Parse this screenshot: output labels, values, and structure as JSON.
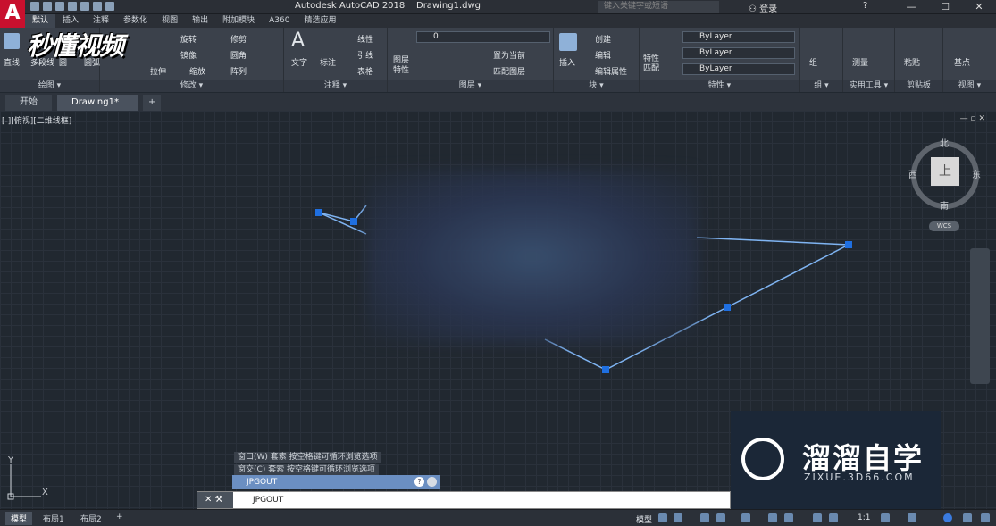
{
  "app": {
    "logo_letter": "A",
    "title": "Autodesk AutoCAD 2018",
    "file": "Drawing1.dwg",
    "search_placeholder": "键入关键字或短语",
    "login": "登录",
    "help": "?"
  },
  "window_buttons": [
    "—",
    "☐",
    "✕"
  ],
  "menu_tabs": [
    "默认",
    "插入",
    "注释",
    "参数化",
    "视图",
    "输出",
    "附加模块",
    "A360",
    "精选应用"
  ],
  "watermark_top": "秒懂视频",
  "ribbon": {
    "draw": {
      "label": "绘图 ▾",
      "tool1": "直线",
      "tool2": "多段线",
      "tool3": "圆",
      "tool4": "圆弧"
    },
    "modify": {
      "label": "修改 ▾",
      "items": [
        "旋转",
        "修剪",
        "镜像",
        "圆角",
        "缩放",
        "阵列",
        "拉伸"
      ]
    },
    "annotation": {
      "label": "注释 ▾",
      "text": "文字",
      "dim": "标注",
      "linear": "线性",
      "leader": "引线",
      "table": "表格"
    },
    "layers": {
      "label": "图层 ▾",
      "props": "图层\n特性",
      "current_layer": "0",
      "set_current": "置为当前",
      "match": "匹配图层"
    },
    "block": {
      "label": "块 ▾",
      "insert": "插入",
      "create": "创建",
      "edit": "编辑",
      "edit_attr": "编辑属性"
    },
    "properties": {
      "label": "特性 ▾",
      "match": "特性\n匹配",
      "color": "ByLayer",
      "linetype": "ByLayer",
      "lineweight": "ByLayer"
    },
    "groups": {
      "label": "组 ▾",
      "group": "组"
    },
    "utilities": {
      "label": "实用工具 ▾",
      "measure": "测量"
    },
    "clipboard": {
      "label": "剪贴板",
      "paste": "粘贴"
    },
    "view": {
      "label": "视图 ▾",
      "base": "基点"
    }
  },
  "doc_tabs": [
    "开始",
    "Drawing1*"
  ],
  "viewport_label": "[-][俯视][二维线框]",
  "viewcube": {
    "face": "上",
    "north": "北",
    "south": "南",
    "east": "东",
    "west": "西",
    "wcs": "WCS"
  },
  "ucs": {
    "x": "X",
    "y": "Y"
  },
  "command_history": [
    "窗口(W) 套索  按空格键可循环浏览选项",
    "窗交(C) 套索  按空格键可循环浏览选项"
  ],
  "command_popup": "JPGOUT",
  "command_input": "JPGOUT",
  "brand": {
    "name": "溜溜自学",
    "url": "ZIXUE.3D66.COM"
  },
  "layout_tabs": [
    "模型",
    "布局1",
    "布局2"
  ],
  "status": {
    "mode": "模型",
    "scale": "1:1"
  }
}
